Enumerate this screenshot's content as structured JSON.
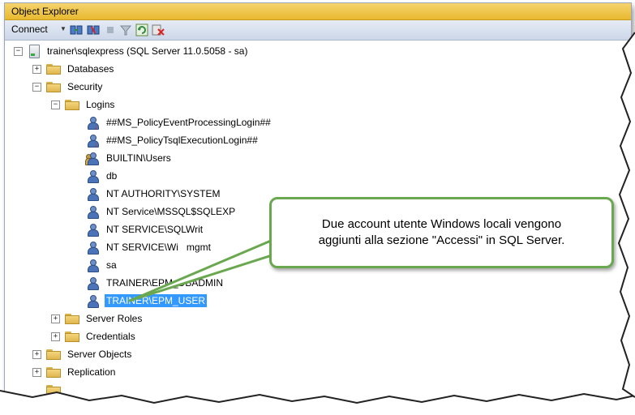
{
  "window": {
    "title": "Object Explorer"
  },
  "toolbar": {
    "connect_label": "Connect",
    "icons": [
      "connect-object-explorer-icon",
      "disconnect-icon",
      "stop-icon",
      "filter-icon",
      "refresh-icon",
      "close-all-icon"
    ]
  },
  "tree": {
    "server": {
      "label": "trainer\\sqlexpress (SQL Server 11.0.5058 - sa)",
      "expander": "−"
    },
    "databases": {
      "label": "Databases",
      "expander": "+"
    },
    "security": {
      "label": "Security",
      "expander": "−"
    },
    "logins": {
      "label": "Logins",
      "expander": "−"
    },
    "logins_items": [
      {
        "label": "##MS_PolicyEventProcessingLogin##",
        "icon": "disabled-login-icon"
      },
      {
        "label": "##MS_PolicyTsqlExecutionLogin##",
        "icon": "disabled-login-icon"
      },
      {
        "label": "BUILTIN\\Users",
        "icon": "group-login-icon"
      },
      {
        "label": "db",
        "icon": "login-icon"
      },
      {
        "label": "NT AUTHORITY\\SYSTEM",
        "icon": "login-icon"
      },
      {
        "label": "NT Service\\MSSQL$SQLEXP",
        "icon": "login-icon"
      },
      {
        "label": "NT SERVICE\\SQLWrit",
        "icon": "login-icon"
      },
      {
        "label": "NT SERVICE\\Wi",
        "label_tail": "mgmt",
        "icon": "login-icon"
      },
      {
        "label": "sa",
        "icon": "login-icon"
      },
      {
        "label": "TRAINER\\EPM_DBADMIN",
        "icon": "login-icon"
      },
      {
        "label": "TRAINER\\EPM_USER",
        "icon": "login-icon",
        "selected": true
      }
    ],
    "server_roles": {
      "label": "Server Roles",
      "expander": "+"
    },
    "credentials": {
      "label": "Credentials",
      "expander": "+"
    },
    "server_objects": {
      "label": "Server Objects",
      "expander": "+"
    },
    "replication": {
      "label": "Replication",
      "expander": "+"
    }
  },
  "callout": {
    "text_line1": "Due account utente Windows locali vengono",
    "text_line2": "aggiunti alla sezione \"Accessi\" in SQL Server."
  },
  "colors": {
    "title_bar": "#e8b930",
    "selection": "#3399ff",
    "callout_border": "#6aa84f"
  }
}
